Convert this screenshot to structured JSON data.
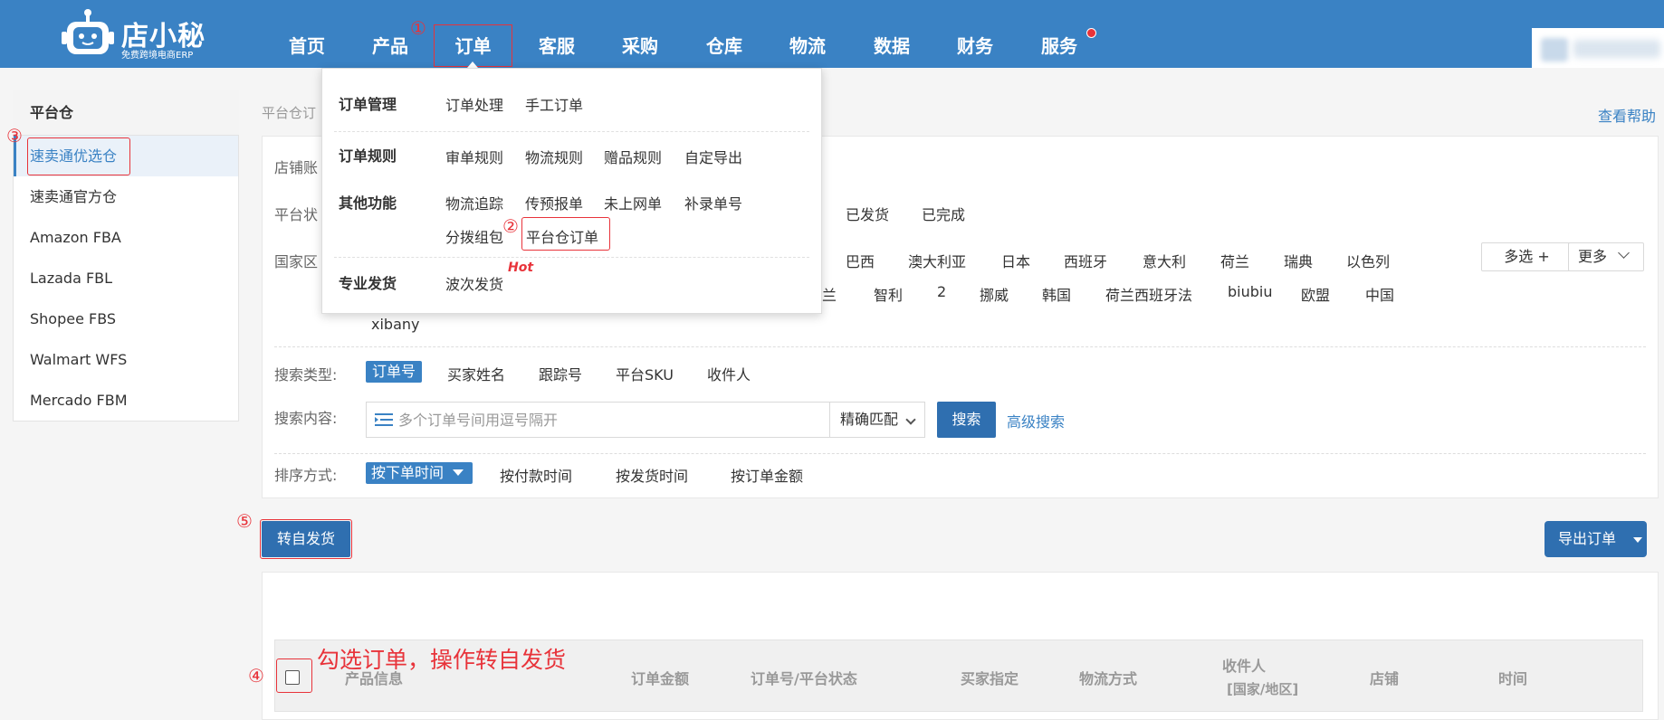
{
  "colors": {
    "nav_bg": "#3a82c4",
    "primary": "#2f6fb0",
    "accent_red": "#e8333a"
  },
  "logo": {
    "title": "店小秘",
    "subtitle": "免费跨境电商ERP",
    "icon": "robot-logo-icon"
  },
  "nav": [
    "首页",
    "产品",
    "订单",
    "客服",
    "采购",
    "仓库",
    "物流",
    "数据",
    "财务",
    "服务"
  ],
  "markers": {
    "m1": "①",
    "m2": "②",
    "m3": "③",
    "m4": "④",
    "m5": "⑤"
  },
  "dropdown": {
    "g1": "订单管理",
    "g1_items": [
      "订单处理",
      "手工订单"
    ],
    "g2": "订单规则",
    "g2_items": [
      "审单规则",
      "物流规则",
      "赠品规则",
      "自定导出"
    ],
    "g3": "其他功能",
    "g3_items": [
      "物流追踪",
      "传预报单",
      "未上网单",
      "补录单号"
    ],
    "g3_row2": [
      "分拨组包",
      "平台仓订单"
    ],
    "g4": "专业发货",
    "g4_items": [
      "波次发货"
    ],
    "hot": "Hot"
  },
  "sidebar": {
    "title": "平台仓",
    "items": [
      "速卖通优选仓",
      "速卖通官方仓",
      "Amazon FBA",
      "Lazada FBL",
      "Shopee FBS",
      "Walmart WFS",
      "Mercado FBM"
    ]
  },
  "breadcrumb": "平台仓订",
  "help": "查看帮助",
  "filters": {
    "shop_label": "店铺账",
    "status_label": "平台状",
    "status_opts": [
      "已发货",
      "已完成"
    ],
    "country_label": "国家区",
    "country_row1": [
      "巴西",
      "澳大利亚",
      "日本",
      "西班牙",
      "意大利",
      "荷兰",
      "瑞典",
      "以色列"
    ],
    "country_row2": [
      "兰",
      "智利",
      "2",
      "挪威",
      "韩国",
      "荷兰西班牙法",
      "biubiu",
      "欧盟",
      "中国"
    ],
    "country_row3": [
      "xibany"
    ],
    "multi_btn": "多选 +",
    "more_btn": "更多"
  },
  "search": {
    "type_label": "搜索类型:",
    "types": [
      "订单号",
      "买家姓名",
      "跟踪号",
      "平台SKU",
      "收件人"
    ],
    "content_label": "搜索内容:",
    "placeholder": "多个订单号间用逗号隔开",
    "match": "精确匹配",
    "btn": "搜索",
    "advanced": "高级搜索"
  },
  "sort": {
    "label": "排序方式:",
    "active": "按下单时间",
    "options": [
      "按付款时间",
      "按发货时间",
      "按订单金额"
    ]
  },
  "actions": {
    "transfer": "转自发货",
    "export": "导出订单"
  },
  "annotation": "勾选订单，操作转自发货",
  "table_headers": {
    "product": "产品信息",
    "amount": "订单金额",
    "order_status": "订单号/平台状态",
    "buyer": "买家指定",
    "logistics": "物流方式",
    "recipient": "收件人",
    "recipient_sub": "[国家/地区]",
    "shop": "店铺",
    "time": "时间"
  }
}
